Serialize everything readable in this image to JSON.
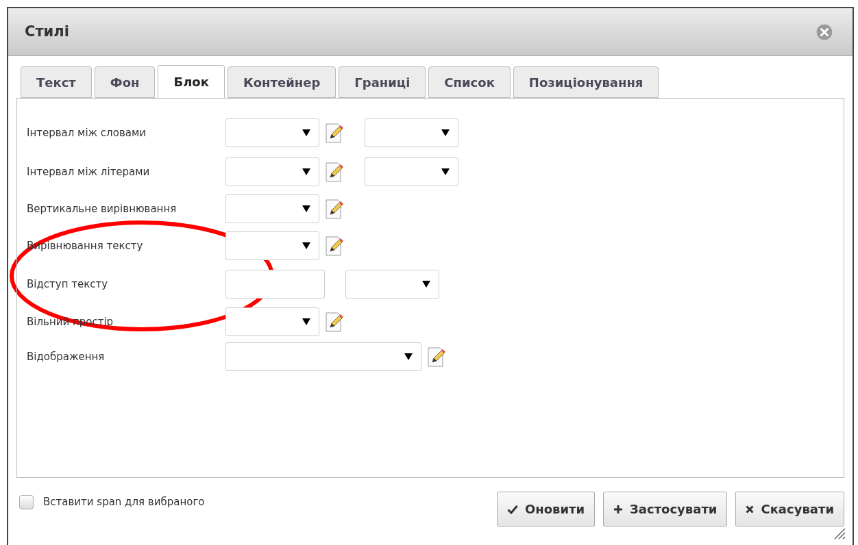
{
  "window": {
    "title": "Стилі"
  },
  "tabs": [
    {
      "label": "Текст",
      "selected": false
    },
    {
      "label": "Фон",
      "selected": false
    },
    {
      "label": "Блок",
      "selected": true
    },
    {
      "label": "Контейнер",
      "selected": false
    },
    {
      "label": "Границі",
      "selected": false
    },
    {
      "label": "Список",
      "selected": false
    },
    {
      "label": "Позиціонування",
      "selected": false
    }
  ],
  "rows": [
    {
      "label": "Інтервал між словами",
      "controls": [
        {
          "kind": "select"
        },
        {
          "kind": "edit"
        },
        {
          "kind": "select"
        }
      ]
    },
    {
      "label": "Інтервал між літерами",
      "controls": [
        {
          "kind": "select"
        },
        {
          "kind": "edit"
        },
        {
          "kind": "select"
        }
      ]
    },
    {
      "label": "Вертикальне вирівнювання",
      "controls": [
        {
          "kind": "select"
        },
        {
          "kind": "edit"
        }
      ]
    },
    {
      "label": "Вирівнювання тексту",
      "controls": [
        {
          "kind": "select"
        },
        {
          "kind": "edit"
        }
      ]
    },
    {
      "label": "Відступ тексту",
      "controls": [
        {
          "kind": "input"
        },
        {
          "kind": "select"
        }
      ]
    },
    {
      "label": "Вільний простір",
      "controls": [
        {
          "kind": "select"
        },
        {
          "kind": "edit"
        }
      ]
    },
    {
      "label": "Відображення",
      "controls": [
        {
          "kind": "wide-select"
        },
        {
          "kind": "edit"
        }
      ]
    }
  ],
  "span_option": {
    "label": "Вставити span для вибраного",
    "checked": false
  },
  "buttons": [
    {
      "kind": "check",
      "label": "Оновити"
    },
    {
      "kind": "plus",
      "label": "Застосувати"
    },
    {
      "kind": "cross",
      "label": "Скасувати"
    }
  ]
}
